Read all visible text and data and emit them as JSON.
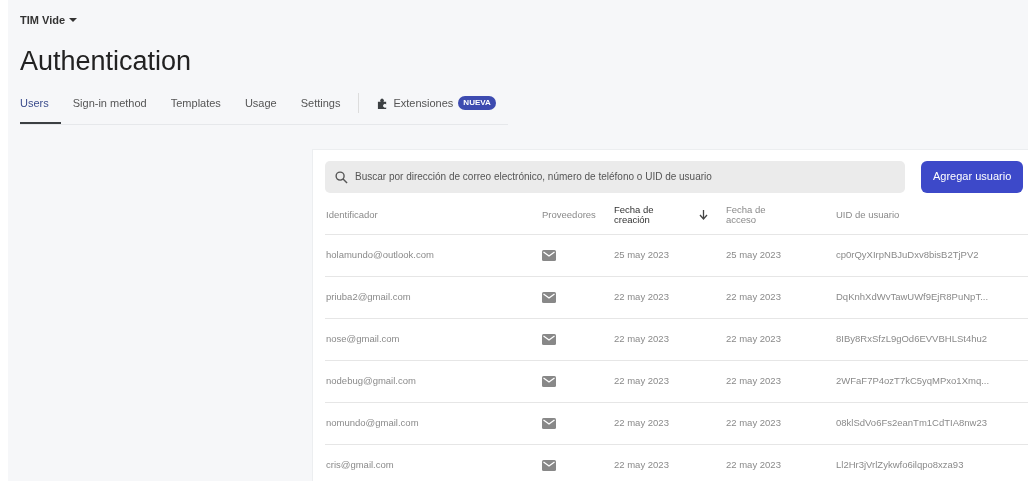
{
  "project": {
    "name": "TIM Vide"
  },
  "title": "Authentication",
  "tabs": [
    {
      "label": "Users",
      "selected": true
    },
    {
      "label": "Sign-in method",
      "selected": false
    },
    {
      "label": "Templates",
      "selected": false
    },
    {
      "label": "Usage",
      "selected": false
    },
    {
      "label": "Settings",
      "selected": false
    },
    {
      "label": "Extensiones",
      "selected": false,
      "badge": "NUEVA"
    }
  ],
  "search": {
    "placeholder": "Buscar por dirección de correo electrónico, número de teléfono o UID de usuario"
  },
  "add_button": "Agregar usuario",
  "table": {
    "columns": [
      {
        "label": "Identificador",
        "sorted": false
      },
      {
        "label": "Proveedores",
        "sorted": false
      },
      {
        "label": "Fecha de creación",
        "sorted": true
      },
      {
        "label": "Fecha de acceso",
        "sorted": false
      },
      {
        "label": "UID de usuario",
        "sorted": false
      }
    ],
    "rows": [
      {
        "identifier": "holamundo@outlook.com",
        "created": "25 may 2023",
        "accessed": "25 may 2023",
        "uid": "cp0rQyXIrpNBJuDxv8bisB2TjPV2"
      },
      {
        "identifier": "priuba2@gmail.com",
        "created": "22 may 2023",
        "accessed": "22 may 2023",
        "uid": "DqKnhXdWvTawUWf9EjR8PuNpT..."
      },
      {
        "identifier": "nose@gmail.com",
        "created": "22 may 2023",
        "accessed": "22 may 2023",
        "uid": "8IBy8RxSfzL9gOd6EVVBHLSt4hu2"
      },
      {
        "identifier": "nodebug@gmail.com",
        "created": "22 may 2023",
        "accessed": "22 may 2023",
        "uid": "2WFaF7P4ozT7kC5yqMPxo1Xmq..."
      },
      {
        "identifier": "nomundo@gmail.com",
        "created": "22 may 2023",
        "accessed": "22 may 2023",
        "uid": "08klSdVo6Fs2eanTm1CdTIA8nw23"
      },
      {
        "identifier": "cris@gmail.com",
        "created": "22 may 2023",
        "accessed": "22 may 2023",
        "uid": "Ll2Hr3jVrlZykwfo6ilqpo8xza93"
      }
    ]
  }
}
